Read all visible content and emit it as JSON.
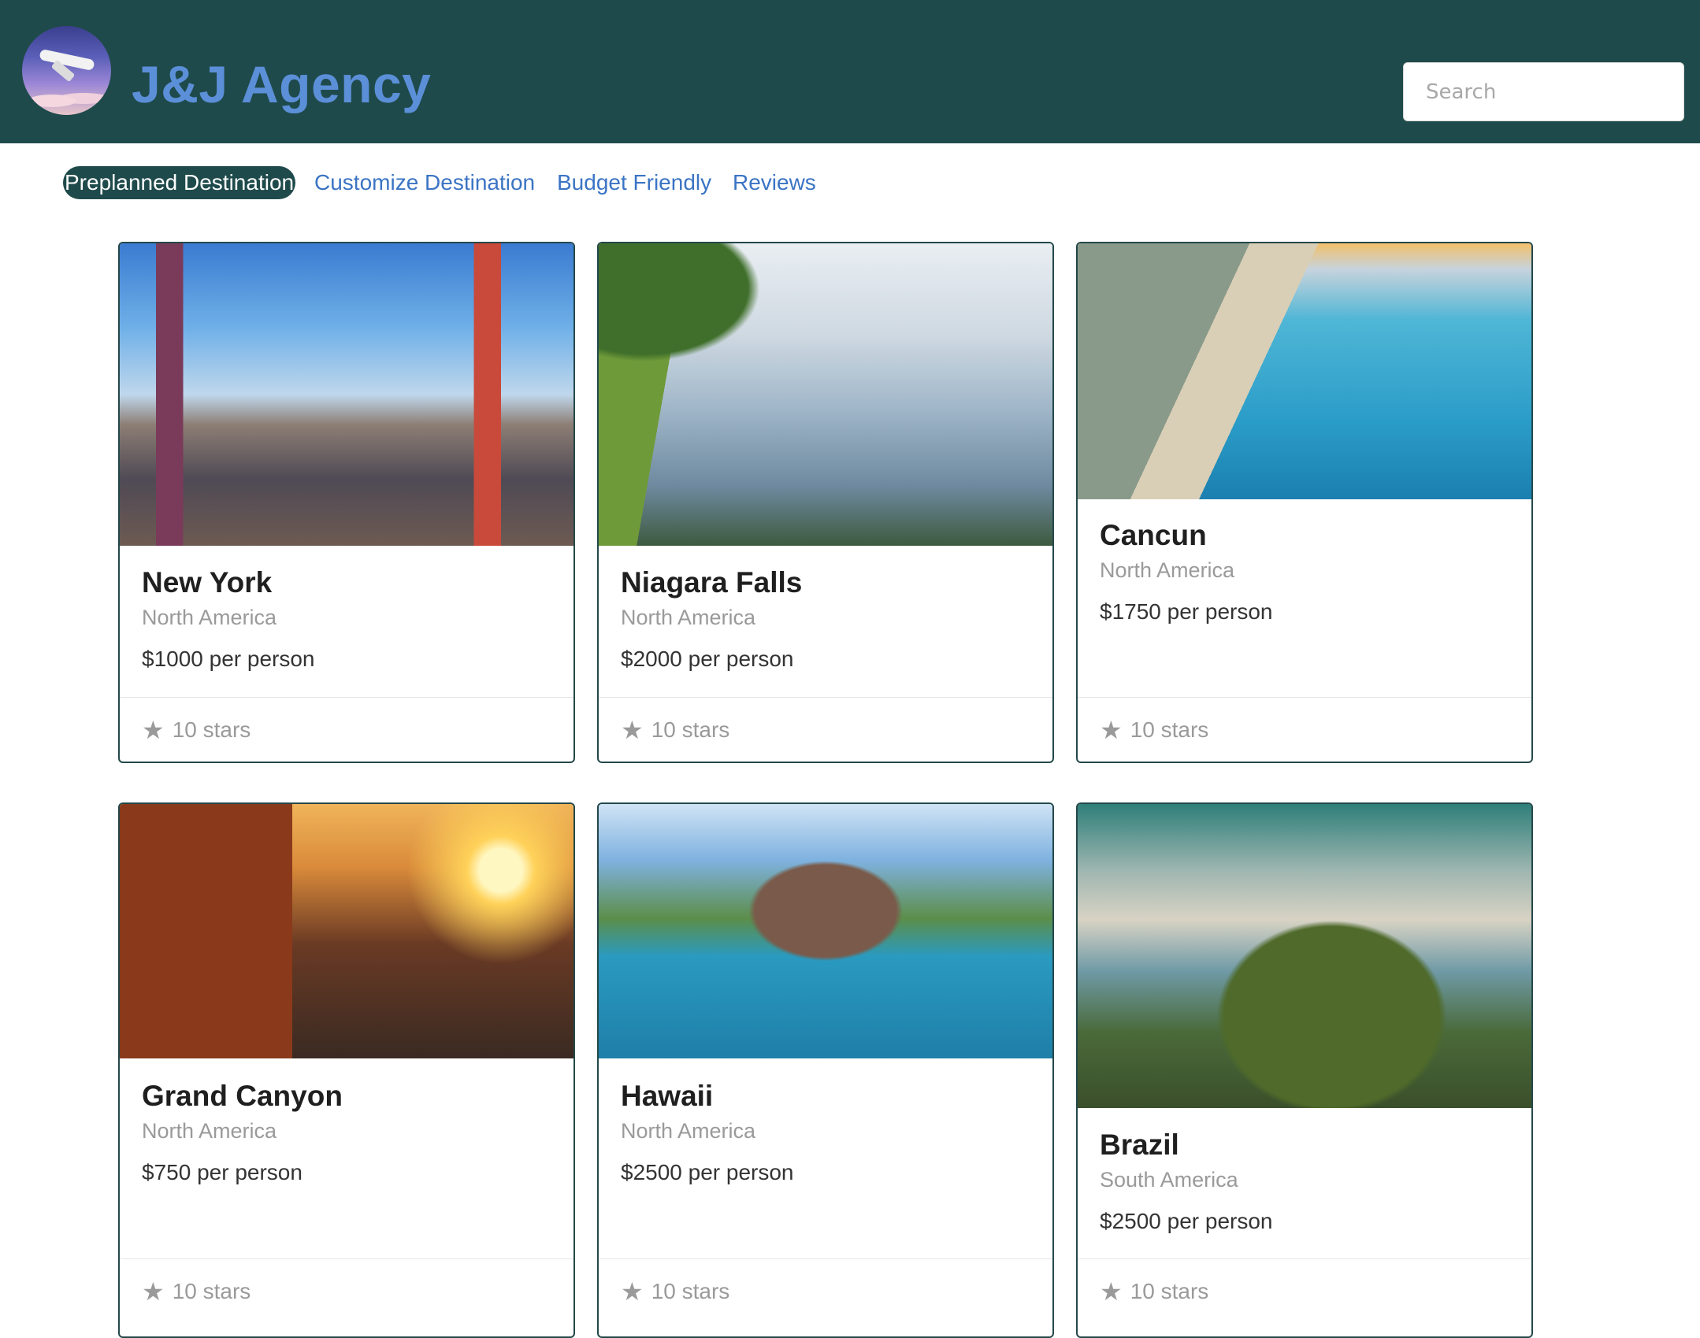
{
  "header": {
    "brand": "J&J Agency",
    "search_placeholder": "Search",
    "colors": {
      "header_bg": "#1f4a4b",
      "brand": "#5b8fd8"
    }
  },
  "nav": {
    "items": [
      {
        "label": "Preplanned Destination",
        "active": true
      },
      {
        "label": "Customize Destination",
        "active": false
      },
      {
        "label": "Budget Friendly",
        "active": false
      },
      {
        "label": "Reviews",
        "active": false
      }
    ]
  },
  "cards": [
    {
      "title": "New York",
      "region": "North America",
      "price": "$1000 per person",
      "rating": "10 stars",
      "image": "times-square-photo"
    },
    {
      "title": "Niagara Falls",
      "region": "North America",
      "price": "$2000 per person",
      "rating": "10 stars",
      "image": "niagara-falls-photo"
    },
    {
      "title": "Cancun",
      "region": "North America",
      "price": "$1750 per person",
      "rating": "10 stars",
      "image": "cancun-beach-photo"
    },
    {
      "title": "Grand Canyon",
      "region": "North America",
      "price": "$750 per person",
      "rating": "10 stars",
      "image": "grand-canyon-photo"
    },
    {
      "title": "Hawaii",
      "region": "North America",
      "price": "$2500 per person",
      "rating": "10 stars",
      "image": "hawaii-island-photo"
    },
    {
      "title": "Brazil",
      "region": "South America",
      "price": "$2500 per person",
      "rating": "10 stars",
      "image": "rio-de-janeiro-photo"
    }
  ]
}
